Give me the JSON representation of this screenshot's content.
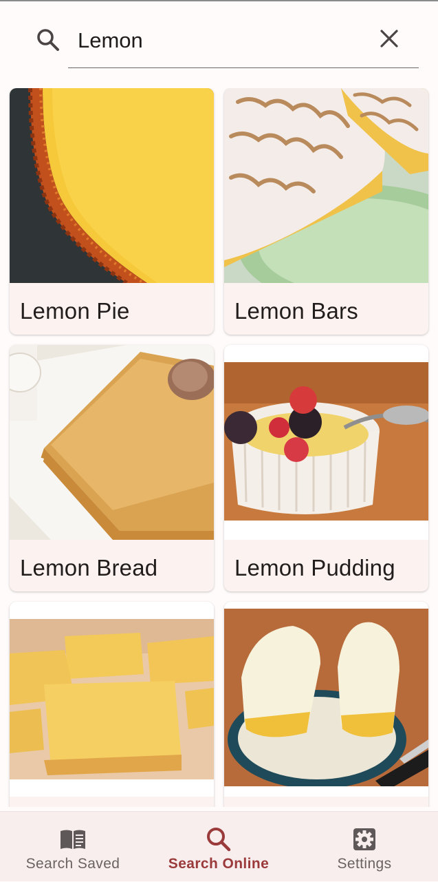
{
  "search": {
    "query": "Lemon",
    "icon": "search-icon",
    "clear_icon": "close-icon"
  },
  "results": [
    {
      "title": "Lemon Pie"
    },
    {
      "title": "Lemon Bars"
    },
    {
      "title": "Lemon Bread"
    },
    {
      "title": "Lemon Pudding"
    },
    {
      "title": ""
    },
    {
      "title": ""
    }
  ],
  "bottom_nav": {
    "items": [
      {
        "label": "Search Saved",
        "icon": "book-icon",
        "active": false
      },
      {
        "label": "Search Online",
        "icon": "search-icon",
        "active": true
      },
      {
        "label": "Settings",
        "icon": "gear-icon",
        "active": false
      }
    ]
  },
  "colors": {
    "accent": "#9b3a3a",
    "background": "#fffbfb",
    "card": "#fcf3f1",
    "nav_background": "#f8eeee"
  }
}
